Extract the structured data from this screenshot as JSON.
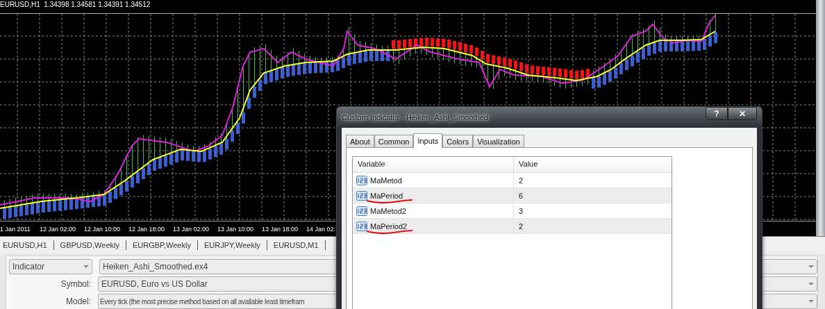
{
  "chart": {
    "header": "EURUSD,H1  1.34398 1.34581 1.34391 1.34512",
    "time_labels": [
      "1 Jan 2011",
      "12 Jan 02:00",
      "12 Jan 10:00",
      "12 Jan 18:00",
      "13 Jan 02:00",
      "13 Jan 10:00",
      "13 Jan 18:00",
      "14 Jan 02:"
    ]
  },
  "chart_tabs": [
    "EURUSD,H1",
    "GBPUSD,Weekly",
    "EURGBP,Weekly",
    "EURJPY,Weekly",
    "EURUSD,M1"
  ],
  "tester": {
    "type_dropdown": "Indicator",
    "indicator_field": "Heiken_Ashi_Smoothed.ex4",
    "symbol_label": "Symbol:",
    "symbol_field": "EURUSD, Euro vs US Dollar",
    "model_label": "Model:",
    "model_field": "Every tick (the most precise method based on all available least timefram"
  },
  "dialog": {
    "title": "Custom Indicator - Heiken_Ashi_Smoothed",
    "title_buttons": [
      "?",
      "✕"
    ],
    "tabs": [
      {
        "label": "About",
        "selected": false
      },
      {
        "label": "Common",
        "selected": false
      },
      {
        "label": "Inputs",
        "selected": true
      },
      {
        "label": "Colors",
        "selected": false
      },
      {
        "label": "Visualization",
        "selected": false
      }
    ],
    "table": {
      "columns": [
        "Variable",
        "Value"
      ],
      "rows": [
        {
          "variable": "MaMetod",
          "value": "2",
          "underlined": false
        },
        {
          "variable": "MaPeriod",
          "value": "6",
          "underlined": true
        },
        {
          "variable": "MaMetod2",
          "value": "3",
          "underlined": false
        },
        {
          "variable": "MaPeriod2",
          "value": "2",
          "underlined": true
        }
      ]
    }
  }
}
